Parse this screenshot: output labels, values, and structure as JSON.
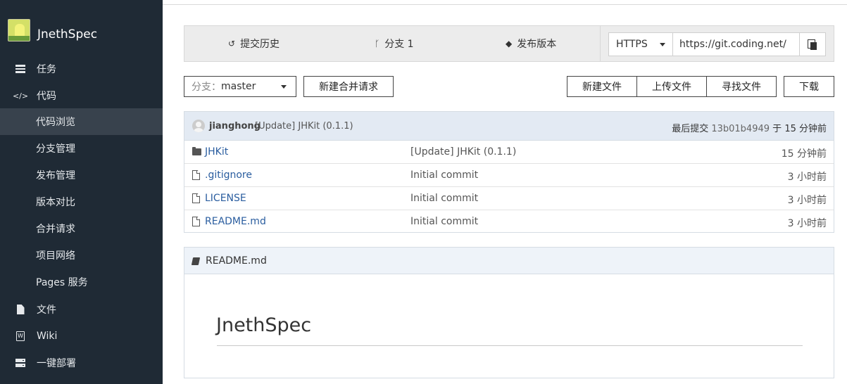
{
  "sidebar": {
    "project_name": "JnethSpec",
    "items": [
      {
        "label": "任务",
        "icon": "tasks-icon"
      },
      {
        "label": "代码",
        "icon": "code-icon"
      },
      {
        "label": "代码浏览"
      },
      {
        "label": "分支管理"
      },
      {
        "label": "发布管理"
      },
      {
        "label": "版本对比"
      },
      {
        "label": "合并请求"
      },
      {
        "label": "项目网络"
      },
      {
        "label": "Pages 服务"
      },
      {
        "label": "文件",
        "icon": "file-icon"
      },
      {
        "label": "Wiki",
        "icon": "wiki-icon"
      },
      {
        "label": "一键部署",
        "icon": "deploy-icon"
      }
    ],
    "active_item": "代码浏览"
  },
  "stats": {
    "history": "提交历史",
    "branches": "分支 1",
    "releases": "发布版本"
  },
  "clone": {
    "protocol": "HTTPS",
    "url": "https://git.coding.net/"
  },
  "actions": {
    "branch_prefix": "分支：",
    "branch_value": "master",
    "new_merge_request": "新建合并请求",
    "new_file": "新建文件",
    "upload_file": "上传文件",
    "find_file": "寻找文件",
    "download": "下载"
  },
  "commit": {
    "author": "jianghong",
    "message": "[Update] JHKit (0.1.1)",
    "latest_label": "最后提交",
    "hash": "13b01b4949",
    "time_prefix": "于",
    "time": "15 分钟前"
  },
  "files": [
    {
      "type": "folder",
      "name": "JHKit",
      "message": "[Update] JHKit (0.1.1)",
      "time": "15 分钟前"
    },
    {
      "type": "file",
      "name": ".gitignore",
      "message": "Initial commit",
      "time": "3 小时前"
    },
    {
      "type": "file",
      "name": "LICENSE",
      "message": "Initial commit",
      "time": "3 小时前"
    },
    {
      "type": "file",
      "name": "README.md",
      "message": "Initial commit",
      "time": "3 小时前"
    }
  ],
  "readme": {
    "filename": "README.md",
    "heading": "JnethSpec"
  }
}
